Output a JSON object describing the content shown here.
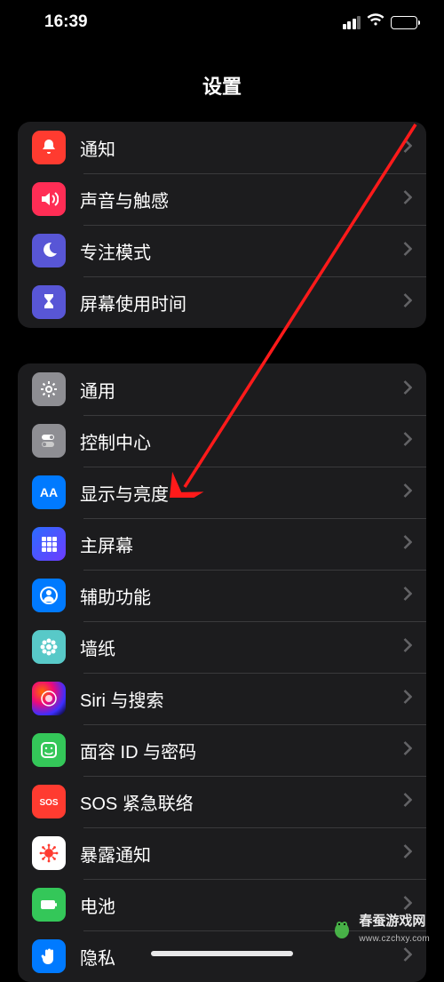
{
  "status": {
    "time": "16:39"
  },
  "title": "设置",
  "groups": [
    {
      "items": [
        {
          "id": "notifications",
          "label": "通知",
          "icon": "bell",
          "color": "c-red"
        },
        {
          "id": "sounds",
          "label": "声音与触感",
          "icon": "speaker",
          "color": "c-pink"
        },
        {
          "id": "focus",
          "label": "专注模式",
          "icon": "moon",
          "color": "c-indigo"
        },
        {
          "id": "screentime",
          "label": "屏幕使用时间",
          "icon": "hourglass",
          "color": "c-indigo"
        }
      ]
    },
    {
      "items": [
        {
          "id": "general",
          "label": "通用",
          "icon": "gear",
          "color": "c-grey"
        },
        {
          "id": "control",
          "label": "控制中心",
          "icon": "switches",
          "color": "c-grey"
        },
        {
          "id": "display",
          "label": "显示与亮度",
          "icon": "aa",
          "color": "c-blue"
        },
        {
          "id": "homescreen",
          "label": "主屏幕",
          "icon": "grid",
          "color": "homescreen-bg"
        },
        {
          "id": "accessibility",
          "label": "辅助功能",
          "icon": "person",
          "color": "c-blue"
        },
        {
          "id": "wallpaper",
          "label": "墙纸",
          "icon": "flower",
          "color": "c-cyan"
        },
        {
          "id": "siri",
          "label": "Siri 与搜索",
          "icon": "siri",
          "color": "siri-bg"
        },
        {
          "id": "faceid",
          "label": "面容 ID 与密码",
          "icon": "face",
          "color": "c-green"
        },
        {
          "id": "sos",
          "label": "SOS 紧急联络",
          "icon": "sos",
          "color": "c-orange"
        },
        {
          "id": "exposure",
          "label": "暴露通知",
          "icon": "virus",
          "color": "c-white"
        },
        {
          "id": "battery",
          "label": "电池",
          "icon": "battery",
          "color": "c-green"
        },
        {
          "id": "privacy",
          "label": "隐私",
          "icon": "hand",
          "color": "c-blue"
        }
      ]
    }
  ],
  "annotation": {
    "target": "display"
  },
  "watermark": {
    "title": "春蚕游戏网",
    "sub": "www.czchxy.com"
  }
}
